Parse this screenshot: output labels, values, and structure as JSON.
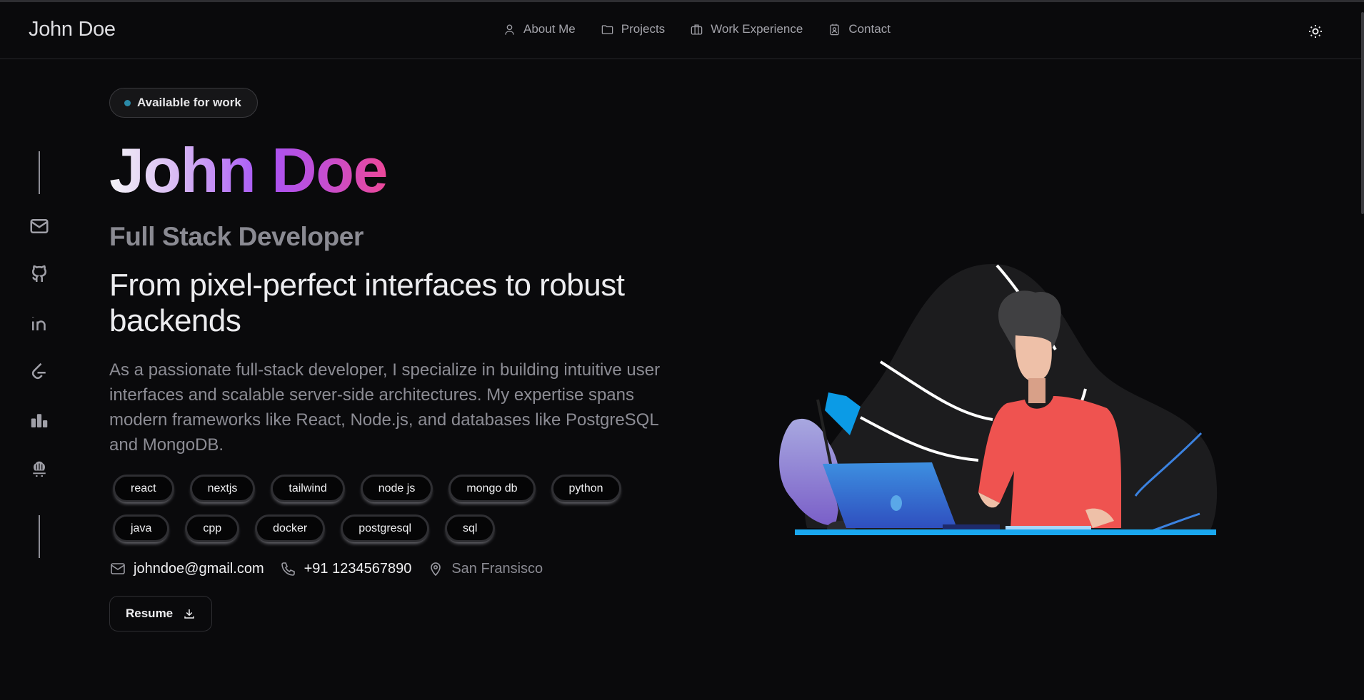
{
  "header": {
    "brand": "John Doe",
    "nav": [
      {
        "label": "About Me",
        "icon": "user-icon"
      },
      {
        "label": "Projects",
        "icon": "folder-icon"
      },
      {
        "label": "Work Experience",
        "icon": "briefcase-icon"
      },
      {
        "label": "Contact",
        "icon": "contact-card-icon"
      }
    ],
    "theme_toggle_icon": "sun-icon"
  },
  "social_links": [
    {
      "name": "email",
      "icon": "mail-icon"
    },
    {
      "name": "github",
      "icon": "github-icon"
    },
    {
      "name": "linkedin",
      "icon": "linkedin-icon"
    },
    {
      "name": "leetcode",
      "icon": "leetcode-icon"
    },
    {
      "name": "stats",
      "icon": "bar-chart-icon"
    },
    {
      "name": "codechef",
      "icon": "chef-hat-icon"
    }
  ],
  "hero": {
    "availability_badge": "Available for work",
    "name": "John Doe",
    "role": "Full Stack Developer",
    "tagline": "From pixel-perfect interfaces to robust backends",
    "summary": "As a passionate full-stack developer, I specialize in building intuitive user interfaces and scalable server-side architectures. My expertise spans modern frameworks like React, Node.js, and databases like PostgreSQL and MongoDB.",
    "skills": [
      "react",
      "nextjs",
      "tailwind",
      "node js",
      "mongo db",
      "python",
      "java",
      "cpp",
      "docker",
      "postgresql",
      "sql"
    ],
    "contact": {
      "email": "johndoe@gmail.com",
      "phone": "+91 1234567890",
      "location": "San Fransisco"
    },
    "resume_label": "Resume"
  },
  "colors": {
    "background": "#0a0a0c",
    "badge_dot": "#2a8aa8",
    "name_gradient": [
      "#f4f4f6",
      "#a855f7",
      "#ec4899"
    ],
    "muted_text": "#8a8a92"
  }
}
